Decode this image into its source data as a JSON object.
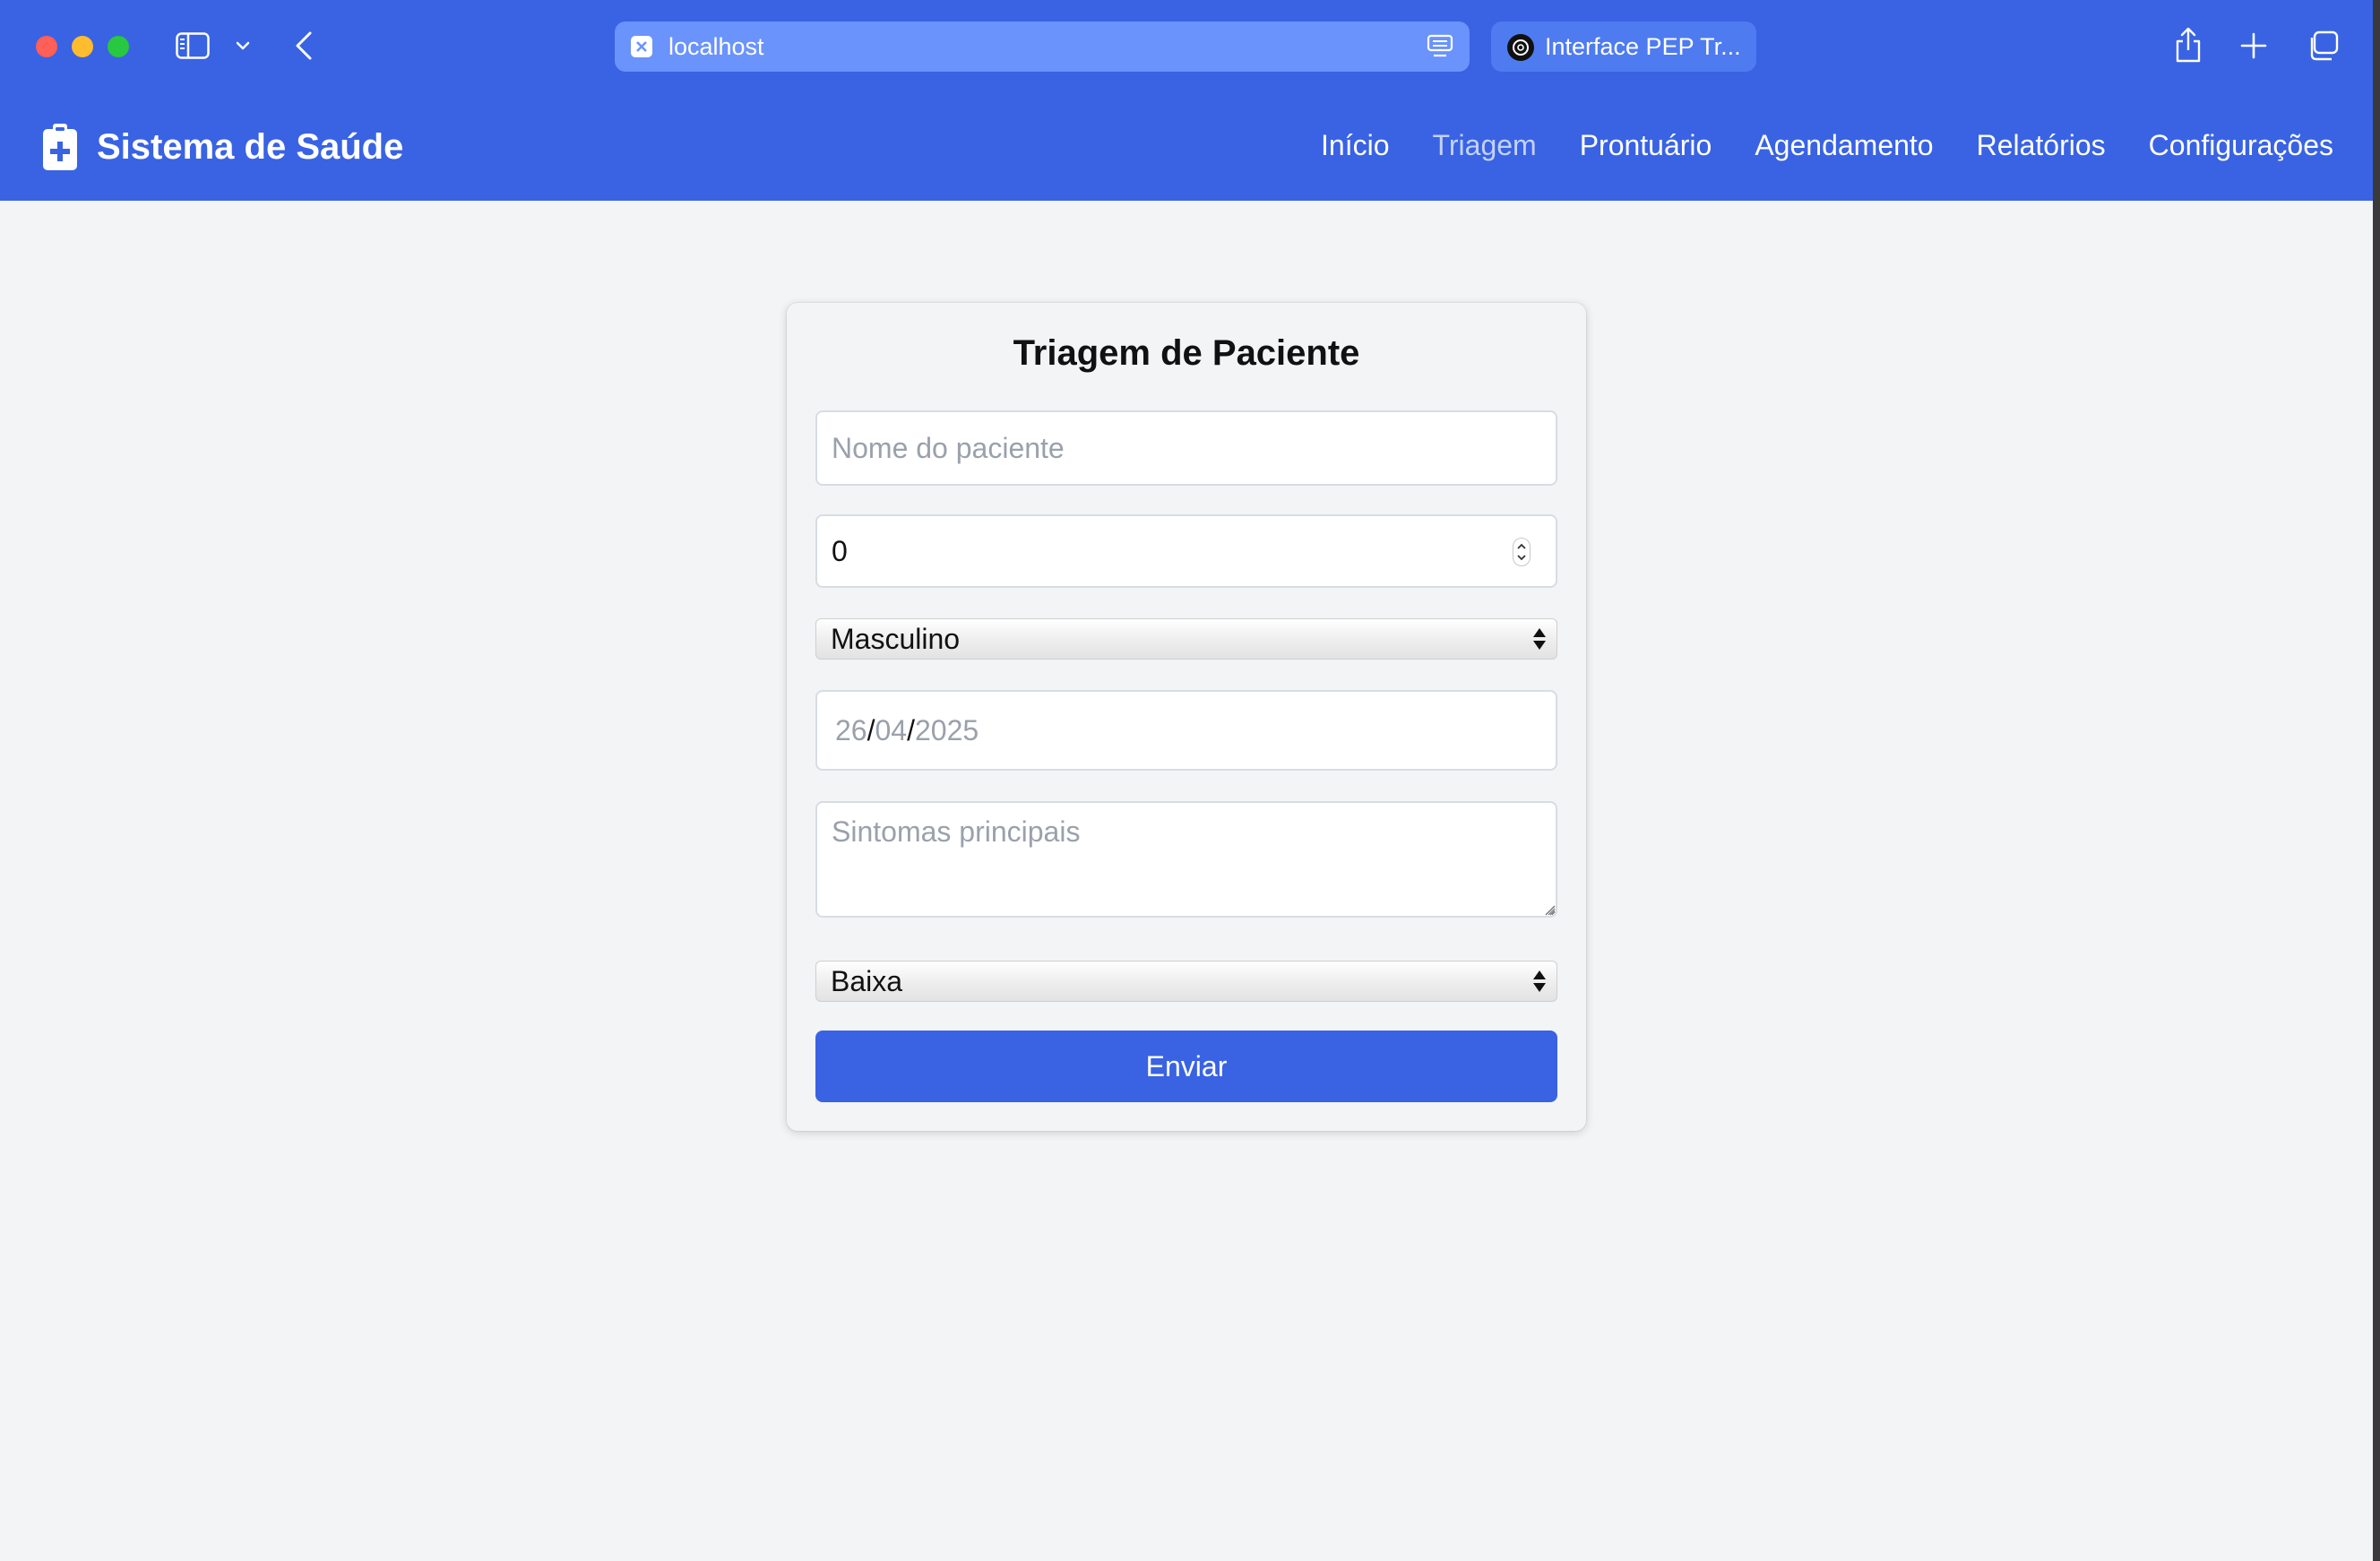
{
  "browser": {
    "address": "localhost",
    "tab_title": "Interface PEP Tr..."
  },
  "app": {
    "brand": "Sistema de Saúde",
    "brand_icon": "medical-clipboard-icon",
    "accent_color": "#3963e3",
    "nav": [
      {
        "label": "Início",
        "active": false
      },
      {
        "label": "Triagem",
        "active": true
      },
      {
        "label": "Prontuário",
        "active": false
      },
      {
        "label": "Agendamento",
        "active": false
      },
      {
        "label": "Relatórios",
        "active": false
      },
      {
        "label": "Configurações",
        "active": false
      }
    ]
  },
  "form": {
    "title": "Triagem de Paciente",
    "name_placeholder": "Nome do paciente",
    "name_value": "",
    "age_value": "0",
    "sex_selected": "Masculino",
    "date": {
      "day": "26",
      "month": "04",
      "year": "2025",
      "separator": "/"
    },
    "symptoms_placeholder": "Sintomas principais",
    "priority_selected": "Baixa",
    "submit_label": "Enviar"
  }
}
